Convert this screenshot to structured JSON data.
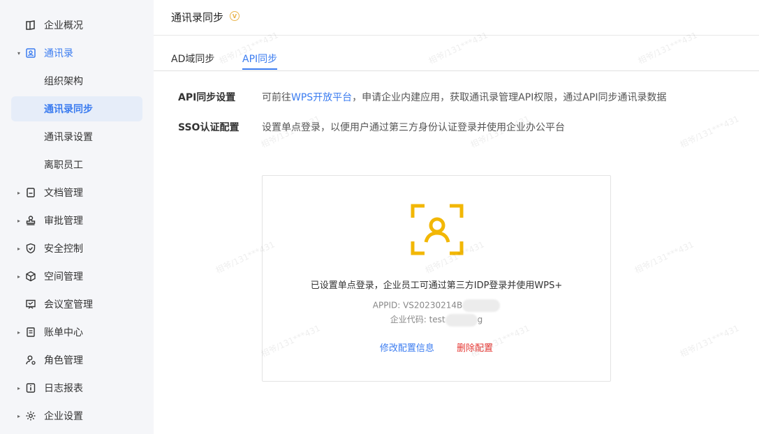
{
  "sidebar": {
    "items": [
      {
        "label": "企业概况",
        "icon": "book-icon",
        "caret": ""
      },
      {
        "label": "通讯录",
        "icon": "contacts-icon",
        "caret": "▾"
      },
      {
        "label": "组织架构"
      },
      {
        "label": "通讯录同步"
      },
      {
        "label": "通讯录设置"
      },
      {
        "label": "离职员工"
      },
      {
        "label": "文档管理",
        "icon": "document-icon",
        "caret": "▸"
      },
      {
        "label": "审批管理",
        "icon": "stamp-icon",
        "caret": "▸"
      },
      {
        "label": "安全控制",
        "icon": "shield-icon",
        "caret": "▸"
      },
      {
        "label": "空间管理",
        "icon": "cube-icon",
        "caret": "▸"
      },
      {
        "label": "会议室管理",
        "icon": "meeting-icon",
        "caret": ""
      },
      {
        "label": "账单中心",
        "icon": "bill-icon",
        "caret": "▸"
      },
      {
        "label": "角色管理",
        "icon": "user-role-icon",
        "caret": ""
      },
      {
        "label": "日志报表",
        "icon": "info-icon",
        "caret": "▸"
      },
      {
        "label": "企业设置",
        "icon": "gear-icon",
        "caret": "▸"
      }
    ]
  },
  "header": {
    "title": "通讯录同步",
    "vip_badge": "V"
  },
  "tabs": [
    {
      "label": "AD域同步"
    },
    {
      "label": "API同步"
    }
  ],
  "api_row": {
    "label": "API同步设置",
    "text_before": "可前往",
    "link": "WPS开放平台",
    "text_after": "，申请企业内建应用，获取通讯录管理API权限，通过API同步通讯录数据"
  },
  "sso_row": {
    "label": "SSO认证配置",
    "text": "设置单点登录，以便用户通过第三方身份认证登录并使用企业办公平台"
  },
  "card": {
    "status": "已设置单点登录，企业员工可通过第三方IDP登录并使用WPS+",
    "appid": "APPID: VS20230214B",
    "company_code_prefix": "企业代码: test",
    "company_code_suffix": "g",
    "edit_label": "修改配置信息",
    "delete_label": "删除配置"
  },
  "watermark": "相爷/131***431",
  "colors": {
    "accent": "#3b7cf0",
    "danger": "#e53935",
    "icon_yellow": "#f2b705"
  }
}
